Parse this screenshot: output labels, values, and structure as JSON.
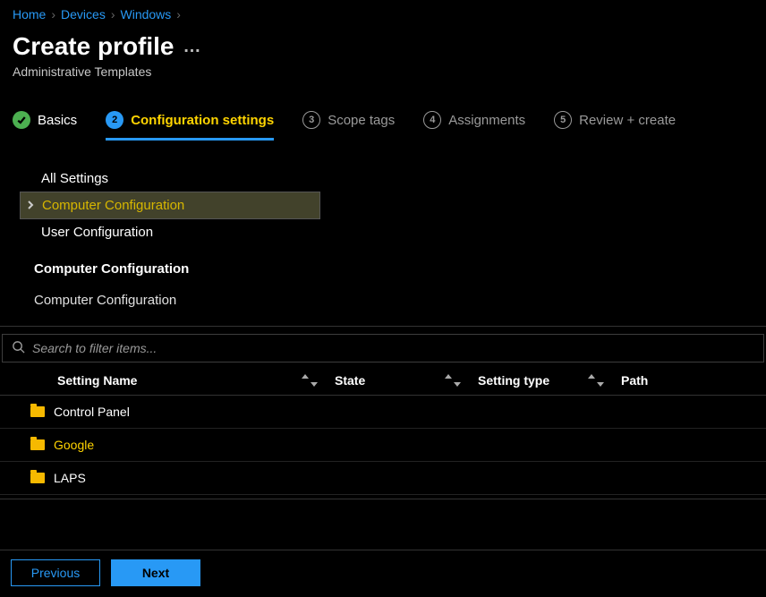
{
  "breadcrumb": {
    "items": [
      {
        "label": "Home"
      },
      {
        "label": "Devices"
      },
      {
        "label": "Windows"
      }
    ]
  },
  "header": {
    "title": "Create profile",
    "subtitle": "Administrative Templates"
  },
  "wizard": {
    "steps": [
      {
        "label": "Basics",
        "state": "done"
      },
      {
        "num": "2",
        "label": "Configuration settings",
        "state": "active"
      },
      {
        "num": "3",
        "label": "Scope tags",
        "state": "pending"
      },
      {
        "num": "4",
        "label": "Assignments",
        "state": "pending"
      },
      {
        "num": "5",
        "label": "Review + create",
        "state": "pending"
      }
    ]
  },
  "tree": {
    "items": [
      {
        "label": "All Settings",
        "expandable": false,
        "selected": false
      },
      {
        "label": "Computer Configuration",
        "expandable": true,
        "selected": true
      },
      {
        "label": "User Configuration",
        "expandable": false,
        "selected": false
      }
    ]
  },
  "section": {
    "heading": "Computer Configuration",
    "path": "Computer Configuration"
  },
  "search": {
    "placeholder": "Search to filter items..."
  },
  "columns": {
    "name": "Setting Name",
    "state": "State",
    "type": "Setting type",
    "path": "Path"
  },
  "rows": [
    {
      "name": "Control Panel",
      "state": "",
      "type": "",
      "path": "",
      "highlight": false
    },
    {
      "name": "Google",
      "state": "",
      "type": "",
      "path": "",
      "highlight": true
    },
    {
      "name": "LAPS",
      "state": "",
      "type": "",
      "path": "",
      "highlight": false
    }
  ],
  "footer": {
    "previous": "Previous",
    "next": "Next"
  }
}
